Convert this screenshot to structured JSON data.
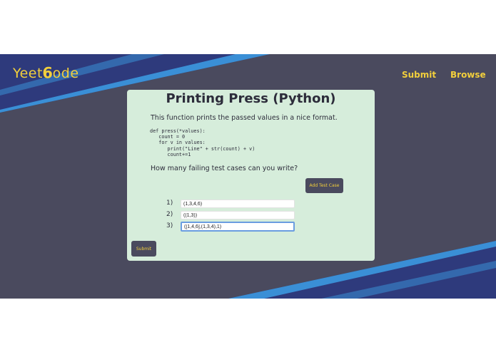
{
  "header": {
    "logo_prefix": "Yeet",
    "logo_mark": "6",
    "logo_suffix": "ode",
    "nav": [
      "Submit",
      "Browse"
    ]
  },
  "problem": {
    "title": "Printing Press (Python)",
    "description": "This function prints the passed values in a nice format.",
    "code": "def press(*values):\n   count = 0\n   for v in values:\n      print(\"Line\" + str(count) + v)\n      count+=1",
    "question": "How many failing test cases can you write?"
  },
  "buttons": {
    "add_test_case": "Add Test Case",
    "submit": "Submit"
  },
  "test_cases": [
    {
      "number": "1)",
      "value": "(1,3,4,6)"
    },
    {
      "number": "2)",
      "value": "((1,3))"
    },
    {
      "number": "3)",
      "value": "([1,4,6],(1,3,4),1)"
    }
  ],
  "colors": {
    "background": "#4a4a5e",
    "accent_yellow": "#f2cf3c",
    "card": "#d6eddb",
    "stripe_light": "#3a8fd6",
    "stripe_dark": "#2e3a7c"
  }
}
